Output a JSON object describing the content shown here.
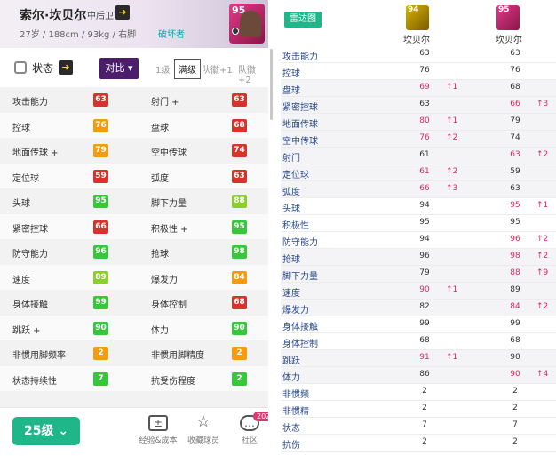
{
  "header": {
    "name": "索尔·坎贝尔",
    "position": "中后卫",
    "info": "27岁 / 188cm / 93kg / 右脚",
    "style": "破坏者",
    "card_rating": "95"
  },
  "controls": {
    "status_label": "状态",
    "compare_label": "对比",
    "compare_arrow": "▾",
    "levels": [
      "1级",
      "满级",
      "队徽+1",
      "队徽+2"
    ],
    "selected_level": "满级"
  },
  "colors": {
    "accent": "#1fb68a",
    "purple": "#4b1d6b",
    "red": "#d9312b",
    "orange": "#f39c12",
    "green": "#37c73a",
    "dark_red": "#c23b22",
    "up": "#e0245e"
  },
  "stats_rows": [
    {
      "l_label": "攻击能力",
      "l_val": "63",
      "l_color": "#d9312b",
      "r_label": "射门 +",
      "r_val": "63",
      "r_color": "#d9312b"
    },
    {
      "l_label": "控球",
      "l_val": "76",
      "l_color": "#f39c12",
      "r_label": "盘球",
      "r_val": "68",
      "r_color": "#d9312b"
    },
    {
      "l_label": "地面传球 +",
      "l_val": "79",
      "l_color": "#f39c12",
      "r_label": "空中传球",
      "r_val": "74",
      "r_color": "#d9312b"
    },
    {
      "l_label": "定位球",
      "l_val": "59",
      "l_color": "#d9312b",
      "r_label": "弧度",
      "r_val": "63",
      "r_color": "#d9312b"
    },
    {
      "l_label": "头球",
      "l_val": "95",
      "l_color": "#37c73a",
      "r_label": "脚下力量",
      "r_val": "88",
      "r_color": "#8ccf2c"
    },
    {
      "l_label": "紧密控球",
      "l_val": "66",
      "l_color": "#d9312b",
      "r_label": "积极性 +",
      "r_val": "95",
      "r_color": "#37c73a"
    },
    {
      "l_label": "防守能力",
      "l_val": "96",
      "l_color": "#37c73a",
      "r_label": "抢球",
      "r_val": "98",
      "r_color": "#37c73a"
    },
    {
      "l_label": "速度",
      "l_val": "89",
      "l_color": "#8ccf2c",
      "r_label": "爆发力",
      "r_val": "84",
      "r_color": "#f39c12"
    },
    {
      "l_label": "身体接触",
      "l_val": "99",
      "l_color": "#37c73a",
      "r_label": "身体控制",
      "r_val": "68",
      "r_color": "#d9312b"
    },
    {
      "l_label": "跳跃 +",
      "l_val": "90",
      "l_color": "#37c73a",
      "r_label": "体力",
      "r_val": "90",
      "r_color": "#37c73a"
    },
    {
      "l_label": "非惯用脚频率",
      "l_val": "2",
      "l_color": "#f39c12",
      "r_label": "非惯用脚精度",
      "r_val": "2",
      "r_color": "#f39c12"
    },
    {
      "l_label": "状态持续性",
      "l_val": "7",
      "l_color": "#37c73a",
      "r_label": "抗受伤程度",
      "r_val": "2",
      "r_color": "#37c73a"
    }
  ],
  "bottom": {
    "level_label": "25级",
    "nav": [
      {
        "label": "经验&成本",
        "icon": "plus-minus-icon"
      },
      {
        "label": "收藏球员",
        "icon": "star-icon"
      },
      {
        "label": "社区",
        "icon": "chat-icon",
        "badge": "202"
      }
    ]
  },
  "compare": {
    "radar_label": "雷达图",
    "players": [
      {
        "name": "坎贝尔",
        "rating": "94",
        "card_color": "gold"
      },
      {
        "name": "坎贝尔",
        "rating": "95",
        "card_color": "pink"
      }
    ],
    "rows": [
      {
        "name": "攻击能力",
        "v1": "63",
        "d1": "",
        "v2": "63",
        "d2": ""
      },
      {
        "name": "控球",
        "v1": "76",
        "d1": "",
        "v2": "76",
        "d2": ""
      },
      {
        "name": "盘球",
        "v1": "69",
        "d1": "↑1",
        "v2": "68",
        "d2": ""
      },
      {
        "name": "紧密控球",
        "v1": "63",
        "d1": "",
        "v2": "66",
        "d2": "↑3"
      },
      {
        "name": "地面传球",
        "v1": "80",
        "d1": "↑1",
        "v2": "79",
        "d2": ""
      },
      {
        "name": "空中传球",
        "v1": "76",
        "d1": "↑2",
        "v2": "74",
        "d2": ""
      },
      {
        "name": "射门",
        "v1": "61",
        "d1": "",
        "v2": "63",
        "d2": "↑2"
      },
      {
        "name": "定位球",
        "v1": "61",
        "d1": "↑2",
        "v2": "59",
        "d2": ""
      },
      {
        "name": "弧度",
        "v1": "66",
        "d1": "↑3",
        "v2": "63",
        "d2": ""
      },
      {
        "name": "头球",
        "v1": "94",
        "d1": "",
        "v2": "95",
        "d2": "↑1"
      },
      {
        "name": "积极性",
        "v1": "95",
        "d1": "",
        "v2": "95",
        "d2": ""
      },
      {
        "name": "防守能力",
        "v1": "94",
        "d1": "",
        "v2": "96",
        "d2": "↑2"
      },
      {
        "name": "抢球",
        "v1": "96",
        "d1": "",
        "v2": "98",
        "d2": "↑2"
      },
      {
        "name": "脚下力量",
        "v1": "79",
        "d1": "",
        "v2": "88",
        "d2": "↑9"
      },
      {
        "name": "速度",
        "v1": "90",
        "d1": "↑1",
        "v2": "89",
        "d2": ""
      },
      {
        "name": "爆发力",
        "v1": "82",
        "d1": "",
        "v2": "84",
        "d2": "↑2"
      },
      {
        "name": "身体接触",
        "v1": "99",
        "d1": "",
        "v2": "99",
        "d2": ""
      },
      {
        "name": "身体控制",
        "v1": "68",
        "d1": "",
        "v2": "68",
        "d2": ""
      },
      {
        "name": "跳跃",
        "v1": "91",
        "d1": "↑1",
        "v2": "90",
        "d2": ""
      },
      {
        "name": "体力",
        "v1": "86",
        "d1": "",
        "v2": "90",
        "d2": "↑4"
      },
      {
        "name": "非惯频",
        "v1": "2",
        "d1": "",
        "v2": "2",
        "d2": ""
      },
      {
        "name": "非惯精",
        "v1": "2",
        "d1": "",
        "v2": "2",
        "d2": ""
      },
      {
        "name": "状态",
        "v1": "7",
        "d1": "",
        "v2": "7",
        "d2": ""
      },
      {
        "name": "抗伤",
        "v1": "2",
        "d1": "",
        "v2": "2",
        "d2": ""
      }
    ]
  }
}
